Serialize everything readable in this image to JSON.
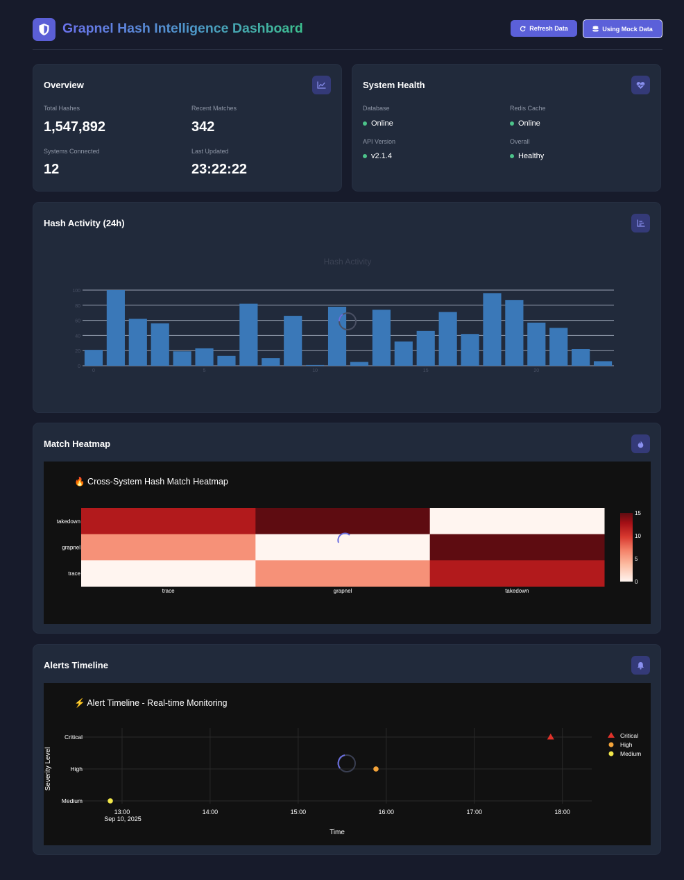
{
  "header": {
    "title": "Grapnel Hash Intelligence Dashboard",
    "refresh_label": "Refresh Data",
    "mock_label": "Using Mock Data"
  },
  "overview": {
    "title": "Overview",
    "total_hashes_label": "Total Hashes",
    "total_hashes": "1,547,892",
    "recent_matches_label": "Recent Matches",
    "recent_matches": "342",
    "systems_label": "Systems Connected",
    "systems": "12",
    "last_updated_label": "Last Updated",
    "last_updated": "23:22:22"
  },
  "health": {
    "title": "System Health",
    "database_label": "Database",
    "database": "Online",
    "redis_label": "Redis Cache",
    "redis": "Online",
    "api_label": "API Version",
    "api": "v2.1.4",
    "overall_label": "Overall",
    "overall": "Healthy",
    "status_color": "#4cc38a"
  },
  "hash_activity": {
    "title": "Hash Activity (24h)"
  },
  "heatmap": {
    "title": "Match Heatmap"
  },
  "alerts": {
    "title": "Alerts Timeline"
  },
  "chart_data": [
    {
      "type": "bar",
      "title": "Hash Activity",
      "x": [
        0,
        1,
        2,
        3,
        4,
        5,
        6,
        7,
        8,
        9,
        10,
        11,
        12,
        13,
        14,
        15,
        16,
        17,
        18,
        19,
        20,
        21,
        22,
        23
      ],
      "values": [
        21,
        100,
        62,
        56,
        19,
        23,
        13,
        82,
        10,
        66,
        1,
        78,
        5,
        74,
        32,
        46,
        71,
        42,
        96,
        87,
        57,
        50,
        22,
        6
      ],
      "xticks": [
        0,
        5,
        10,
        15,
        20
      ],
      "yticks": [
        0,
        20,
        40,
        60,
        80,
        100
      ],
      "ylim": [
        0,
        100
      ],
      "color": "#3a78b8",
      "grid": true
    },
    {
      "type": "heatmap",
      "title": "🔥 Cross-System Hash Match Heatmap",
      "x": [
        "trace",
        "grapnel",
        "takedown"
      ],
      "y": [
        "takedown",
        "grapnel",
        "trace"
      ],
      "z": [
        [
          12,
          15,
          0
        ],
        [
          6,
          0,
          15
        ],
        [
          0,
          6,
          12
        ]
      ],
      "zlim": [
        0,
        15
      ],
      "colorbar_ticks": [
        0,
        5,
        10,
        15
      ],
      "colorscale": "Reds"
    },
    {
      "type": "scatter",
      "title": "⚡ Alert Timeline - Real-time Monitoring",
      "xlabel": "Time",
      "ylabel": "Severity Level",
      "date_label": "Sep 10, 2025",
      "xticks": [
        "13:00",
        "14:00",
        "15:00",
        "16:00",
        "17:00",
        "18:00"
      ],
      "xlim": [
        "12:26",
        "18:20"
      ],
      "categories": [
        "Medium",
        "High",
        "Critical"
      ],
      "legend_position": "right",
      "series": [
        {
          "name": "Critical",
          "marker": "triangle",
          "color": "#e0322a",
          "points": [
            {
              "x": "17:52",
              "y": "Critical"
            }
          ]
        },
        {
          "name": "High",
          "marker": "circle",
          "color": "#f4a43a",
          "points": [
            {
              "x": "15:53",
              "y": "High"
            }
          ]
        },
        {
          "name": "Medium",
          "marker": "circle",
          "color": "#f2e84a",
          "points": [
            {
              "x": "12:52",
              "y": "Medium"
            }
          ]
        }
      ]
    }
  ]
}
